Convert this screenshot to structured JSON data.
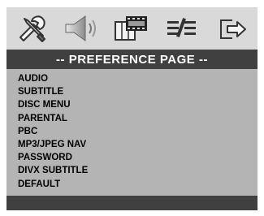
{
  "icons": [
    {
      "name": "general-setup-icon",
      "semantic": "wrench-screwdriver"
    },
    {
      "name": "audio-setup-icon",
      "semantic": "speaker"
    },
    {
      "name": "video-setup-icon",
      "semantic": "film"
    },
    {
      "name": "preference-icon",
      "semantic": "sliders"
    },
    {
      "name": "exit-icon",
      "semantic": "exit-arrow"
    }
  ],
  "header": {
    "title": "-- PREFERENCE PAGE --"
  },
  "menu": {
    "items": [
      "AUDIO",
      "SUBTITLE",
      "DISC MENU",
      "PARENTAL",
      "PBC",
      "MP3/JPEG NAV",
      "PASSWORD",
      "DIVX SUBTITLE",
      "DEFAULT"
    ]
  },
  "colors": {
    "icon_bar": "#d9d9d9",
    "header_bg": "#404040",
    "header_text": "#ffffff",
    "menu_bg": "#b4b4b4",
    "menu_text": "#000000"
  }
}
